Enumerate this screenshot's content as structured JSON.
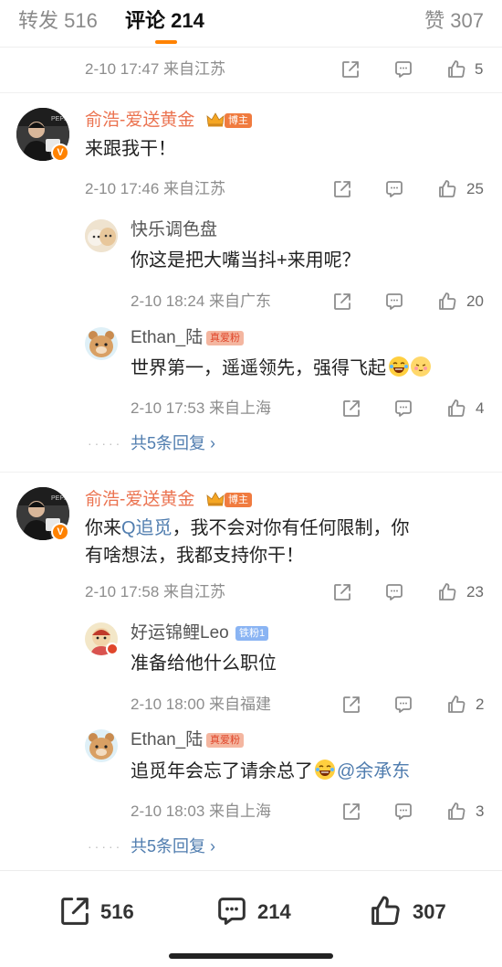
{
  "tabs": {
    "repost": "转发 516",
    "comment": "评论 214",
    "like": "赞 307"
  },
  "colors": {
    "accent": "#ff8200",
    "username": "#eb7350",
    "link": "#507daf",
    "meta": "#8d8d8d"
  },
  "icons": {
    "share": "share-icon",
    "reply": "comment-icon",
    "like": "thumbs-up-icon"
  },
  "row0": {
    "meta": "2-10 17:47  来自江苏",
    "likes": "5"
  },
  "c1": {
    "user": "俞浩-爱送黄金",
    "tag": "博主",
    "text": "来跟我干！",
    "meta": "2-10 17:46  来自江苏",
    "likes": "25",
    "replies": [
      {
        "user": "快乐调色盘",
        "text": "你这是把大嘴当抖+来用呢？",
        "meta": "2-10 18:24  来自广东",
        "likes": "20"
      },
      {
        "user": "Ethan_陆",
        "tag": "真爱粉",
        "text": "世界第一，遥遥领先，强得飞起",
        "meta": "2-10 17:53  来自上海",
        "likes": "4"
      }
    ],
    "more": "共5条回复 ›"
  },
  "c2": {
    "user": "俞浩-爱送黄金",
    "tag": "博主",
    "text_a": "你来",
    "mention": "Q追觅",
    "text_b": "，我不会对你有任何限制，你",
    "text_c": "有啥想法，我都支持你干！",
    "meta": "2-10 17:58  来自江苏",
    "likes": "23",
    "replies": [
      {
        "user": "好运锦鲤Leo",
        "tag": "铁粉1",
        "text": "准备给他什么职位",
        "meta": "2-10 18:00  来自福建",
        "likes": "2"
      },
      {
        "user": "Ethan_陆",
        "tag": "真爱粉",
        "text": "追觅年会忘了请余总了",
        "at": "@余承东",
        "meta": "2-10 18:03  来自上海",
        "likes": "3"
      }
    ],
    "more": "共5条回复 ›"
  },
  "bottom": {
    "reposts": "516",
    "comments": "214",
    "likes": "307"
  }
}
